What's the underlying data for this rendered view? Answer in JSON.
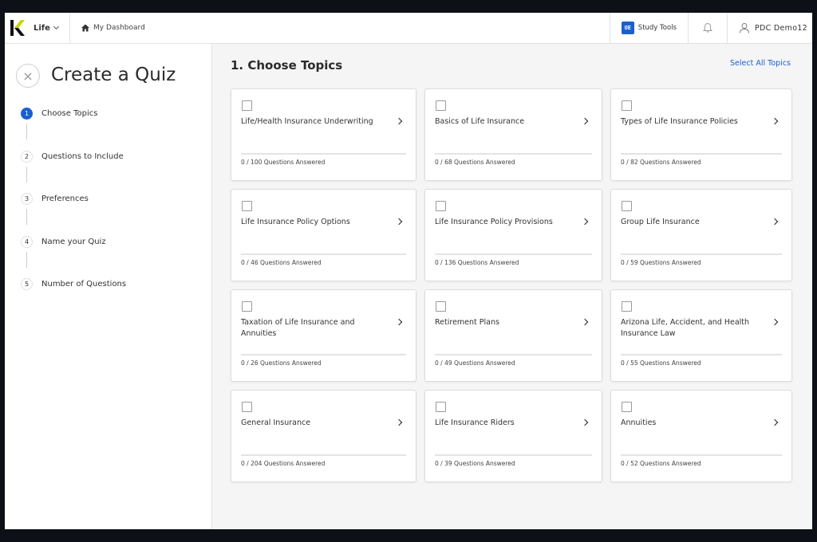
{
  "header": {
    "brand_label": "Life",
    "breadcrumb_label": "My Dashboard",
    "study_tools_badge": "OE",
    "study_tools_label": "Study Tools",
    "user_label": "PDC Demo12",
    "accent_color": "#1a5fd0"
  },
  "sidebar": {
    "title": "Create a Quiz",
    "close_glyph": "×",
    "steps": [
      {
        "num": "1",
        "label": "Choose Topics",
        "active": true
      },
      {
        "num": "2",
        "label": "Questions to Include",
        "active": false
      },
      {
        "num": "3",
        "label": "Preferences",
        "active": false
      },
      {
        "num": "4",
        "label": "Name your Quiz",
        "active": false
      },
      {
        "num": "5",
        "label": "Number of Questions",
        "active": false
      }
    ]
  },
  "main": {
    "title": "1. Choose Topics",
    "select_all_label": "Select All Topics",
    "topics": [
      {
        "title": "Life/Health Insurance Underwriting",
        "answered": 0,
        "total": 100,
        "count_text": "0 / 100 Questions Answered"
      },
      {
        "title": "Basics of Life Insurance",
        "answered": 0,
        "total": 68,
        "count_text": "0 / 68 Questions Answered"
      },
      {
        "title": "Types of Life Insurance Policies",
        "answered": 0,
        "total": 82,
        "count_text": "0 / 82 Questions Answered"
      },
      {
        "title": "Life Insurance Policy Options",
        "answered": 0,
        "total": 46,
        "count_text": "0 / 46 Questions Answered"
      },
      {
        "title": "Life Insurance Policy Provisions",
        "answered": 0,
        "total": 136,
        "count_text": "0 / 136 Questions Answered"
      },
      {
        "title": "Group Life Insurance",
        "answered": 0,
        "total": 59,
        "count_text": "0 / 59 Questions Answered"
      },
      {
        "title": "Taxation of Life Insurance and Annuities",
        "answered": 0,
        "total": 26,
        "count_text": "0 / 26 Questions Answered"
      },
      {
        "title": "Retirement Plans",
        "answered": 0,
        "total": 49,
        "count_text": "0 / 49 Questions Answered"
      },
      {
        "title": "Arizona Life, Accident, and Health Insurance Law",
        "answered": 0,
        "total": 55,
        "count_text": "0 / 55 Questions Answered"
      },
      {
        "title": "General Insurance",
        "answered": 0,
        "total": 204,
        "count_text": "0 / 204 Questions Answered"
      },
      {
        "title": "Life Insurance Riders",
        "answered": 0,
        "total": 39,
        "count_text": "0 / 39 Questions Answered"
      },
      {
        "title": "Annuities",
        "answered": 0,
        "total": 52,
        "count_text": "0 / 52 Questions Answered"
      }
    ]
  }
}
